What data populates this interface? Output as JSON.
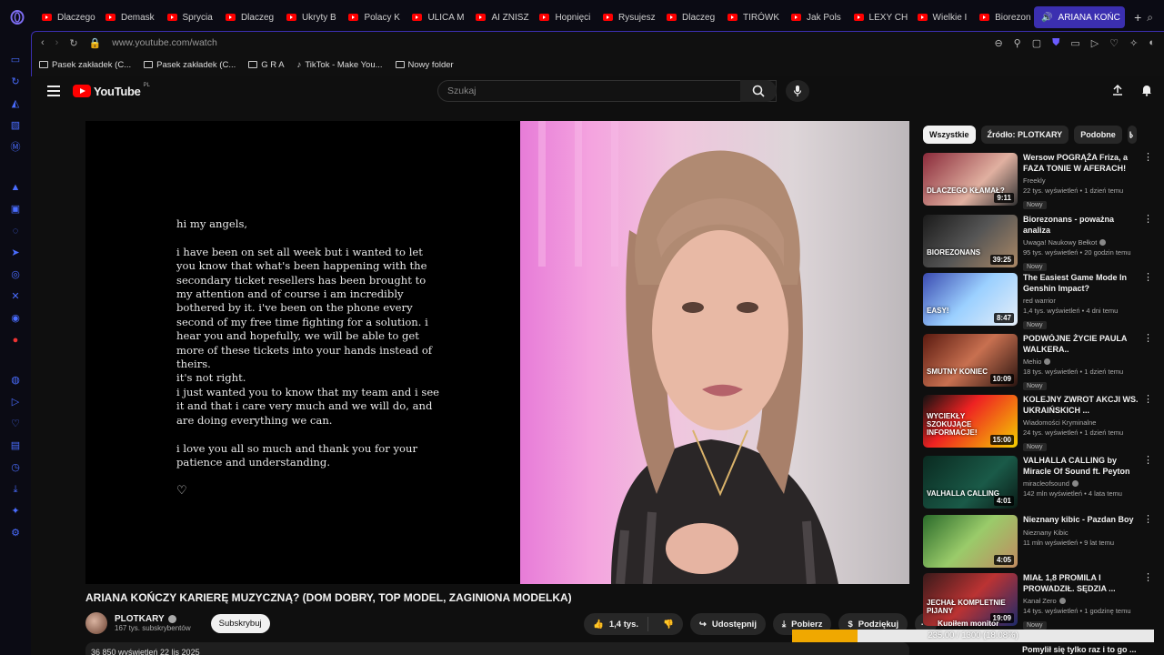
{
  "tabs": [
    {
      "label": "Dlaczego"
    },
    {
      "label": "Demask"
    },
    {
      "label": "Sprycia"
    },
    {
      "label": "Dlaczeg"
    },
    {
      "label": "Ukryty B"
    },
    {
      "label": "Polacy K"
    },
    {
      "label": "ULICA M"
    },
    {
      "label": "AI ZNISZ"
    },
    {
      "label": "Hopnięci"
    },
    {
      "label": "Rysujesz"
    },
    {
      "label": "Dlaczeg"
    },
    {
      "label": "TIRÓWK"
    },
    {
      "label": "Jak Pols"
    },
    {
      "label": "LEXY CH"
    },
    {
      "label": "Wielkie I"
    },
    {
      "label": "Biorezon"
    }
  ],
  "active_tab": "ARIANA KOŃC",
  "address": {
    "url": "www.youtube.com/watch"
  },
  "bookmarks": [
    {
      "label": "Pasek zakładek (C..."
    },
    {
      "label": "Pasek zakładek (C..."
    },
    {
      "label": "G R A"
    },
    {
      "label": "TikTok - Make You..."
    },
    {
      "label": "Nowy folder"
    }
  ],
  "youtube": {
    "logo": "YouTube",
    "region": "PL",
    "search_placeholder": "Szukaj"
  },
  "video": {
    "letter": "hi my angels,\n\ni have been on set all week but i wanted to let you know that what's been happening with the secondary ticket resellers has been brought to my attention and of course i am incredibly bothered by it. i've been on the phone every second of my free time fighting for a solution. i hear you and hopefully, we will be able to get more of these tickets into your hands instead of theirs.\nit's not right.\ni just wanted you to know that my team and i see it and that i care very much and we will do, and are doing everything we can.\n\ni love you all so much and thank you for your patience and understanding.",
    "heart": "♡",
    "title": "ARIANA KOŃCZY KARIERĘ MUZYCZNĄ? (DOM DOBRY, TOP MODEL, ZAGINIONA MODELKA)",
    "channel": "PLOTKARY",
    "subscribers": "167 tys. subskrybentów",
    "subscribe_label": "Subskrybuj",
    "likes": "1,4 tys.",
    "share_label": "Udostępnij",
    "download_label": "Pobierz",
    "thanks_label": "Podziękuj",
    "meta": "36 850 wyświetleń  22 lis 2025"
  },
  "progress": {
    "text": "235.00 / 1300 (18.08%)",
    "fraction": 0.1808
  },
  "chips": [
    "Wszystkie",
    "Źródło: PLOTKARY",
    "Podobne",
    "I"
  ],
  "related": [
    {
      "title": "Wersow POGRĄŻA Friza, a FAZA TONIE W AFERACH!",
      "channel": "Freekly",
      "stats": "22 tys. wyświetleń • 1 dzień temu",
      "badge": "Nowy",
      "duration": "9:11",
      "thumb_text": "DLACZEGO KŁAMAŁ?",
      "verified": false
    },
    {
      "title": "Biorezonans - poważna analiza",
      "channel": "Uwaga! Naukowy Bełkot",
      "stats": "95 tys. wyświetleń • 20 godzin temu",
      "badge": "Nowy",
      "duration": "39:25",
      "thumb_text": "BIOREZONANS",
      "verified": true
    },
    {
      "title": "The Easiest Game Mode In Genshin Impact?",
      "channel": "red warrior",
      "stats": "1,4 tys. wyświetleń • 4 dni temu",
      "badge": "Nowy",
      "duration": "8:47",
      "thumb_text": "EASY!",
      "verified": false
    },
    {
      "title": "PODWÓJNE ŻYCIE PAULA WALKERA..",
      "channel": "Mehio",
      "stats": "18 tys. wyświetleń • 1 dzień temu",
      "badge": "Nowy",
      "duration": "10:09",
      "thumb_text": "SMUTNY KONIEC",
      "verified": true
    },
    {
      "title": "KOLEJNY ZWROT AKCJI WS. UKRAIŃSKICH ...",
      "channel": "Wiadomości Kryminalne",
      "stats": "24 tys. wyświetleń • 1 dzień temu",
      "badge": "Nowy",
      "duration": "15:00",
      "thumb_text": "WYCIEKŁY SZOKUJĄCE INFORMACJE!",
      "verified": false
    },
    {
      "title": "VALHALLA CALLING by Miracle Of Sound ft. Peyton Parrish - ...",
      "channel": "miracleofsound",
      "stats": "142 mln wyświetleń • 4 lata temu",
      "badge": "",
      "duration": "4:01",
      "thumb_text": "VALHALLA CALLING",
      "verified": true
    },
    {
      "title": "Nieznany kibic - Pazdan Boy",
      "channel": "Nieznany Kibic",
      "stats": "11 mln wyświetleń • 9 lat temu",
      "badge": "",
      "duration": "4:05",
      "thumb_text": "",
      "verified": false
    },
    {
      "title": "MIAŁ 1,8 PROMILA I PROWADZIŁ. SĘDZIA ...",
      "channel": "Kanał Zero",
      "stats": "14 tys. wyświetleń • 1 godzinę temu",
      "badge": "Nowy",
      "duration": "19:09",
      "thumb_text": "JECHAŁ KOMPLETNIE PIJANY",
      "verified": true
    }
  ],
  "related_partial": "Pomylił się tylko raz i to go ...",
  "overlay_text": "Kupiłem monitor"
}
